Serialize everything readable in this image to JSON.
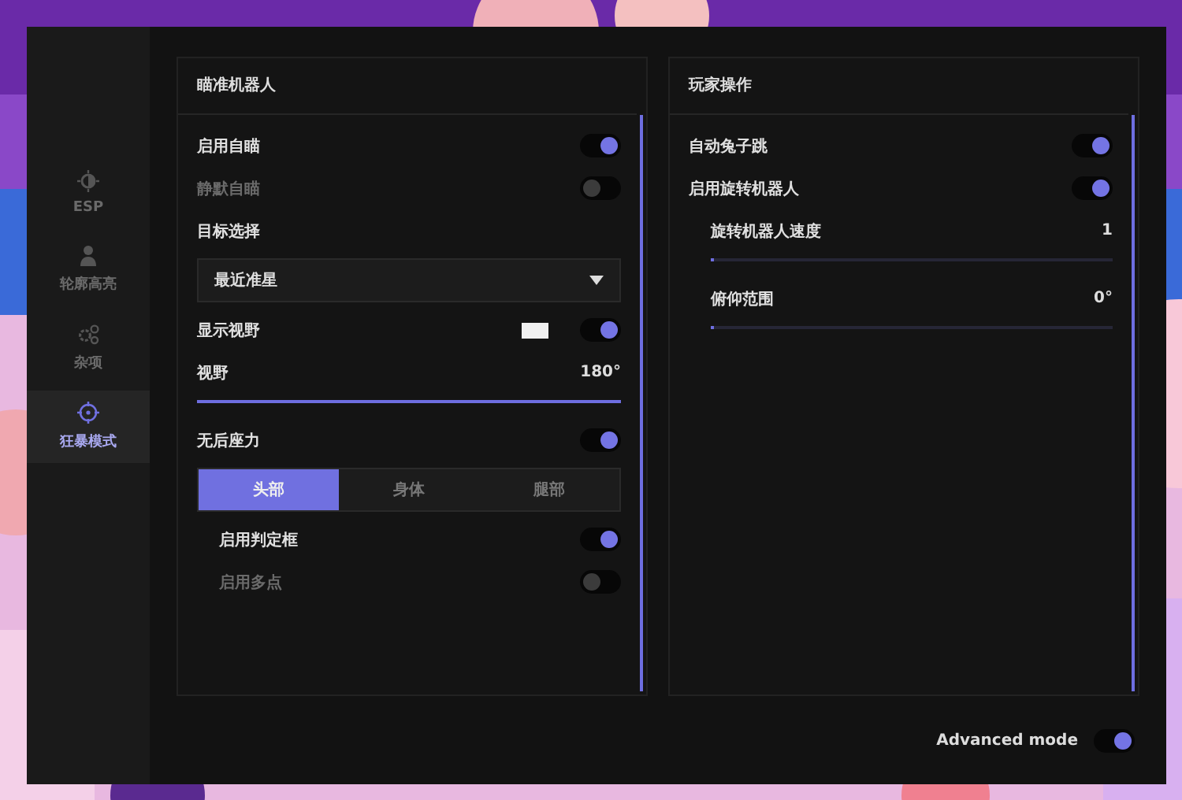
{
  "sidebar": {
    "items": [
      {
        "label": "ESP",
        "selected": false
      },
      {
        "label": "轮廓高亮",
        "selected": false
      },
      {
        "label": "杂项",
        "selected": false
      },
      {
        "label": "狂暴模式",
        "selected": true
      }
    ]
  },
  "panels": [
    {
      "title": "瞄准机器人",
      "rows": [
        {
          "kind": "toggle",
          "label": "启用自瞄",
          "on": true
        },
        {
          "kind": "toggle",
          "label": "静默自瞄",
          "on": false
        },
        {
          "kind": "label",
          "label": "目标选择"
        },
        {
          "kind": "dropdown",
          "value": "最近准星"
        },
        {
          "kind": "toggle",
          "label": "显示视野",
          "on": true,
          "color": "#f0f0f0"
        },
        {
          "kind": "slider",
          "label": "视野",
          "reading": "180°",
          "level": 1
        },
        {
          "kind": "toggle",
          "label": "无后座力",
          "on": true
        },
        {
          "kind": "segmented",
          "options": [
            {
              "label": "头部",
              "selected": true
            },
            {
              "label": "身体",
              "selected": false
            },
            {
              "label": "腿部",
              "selected": false
            }
          ],
          "children": [
            {
              "kind": "toggle",
              "label": "启用判定框",
              "on": true
            },
            {
              "kind": "toggle",
              "label": "启用多点",
              "on": false
            }
          ]
        }
      ]
    },
    {
      "title": "玩家操作",
      "rows": [
        {
          "kind": "toggle",
          "label": "自动兔子跳",
          "on": true
        },
        {
          "kind": "toggle",
          "label": "启用旋转机器人",
          "on": true,
          "children": [
            {
              "kind": "slider",
              "label": "旋转机器人速度",
              "reading": "1",
              "level": 0
            },
            {
              "kind": "slider",
              "label": "俯仰范围",
              "reading": "0°",
              "level": 0
            }
          ]
        }
      ]
    }
  ],
  "footer": {
    "label": "Advanced mode",
    "on": true
  }
}
